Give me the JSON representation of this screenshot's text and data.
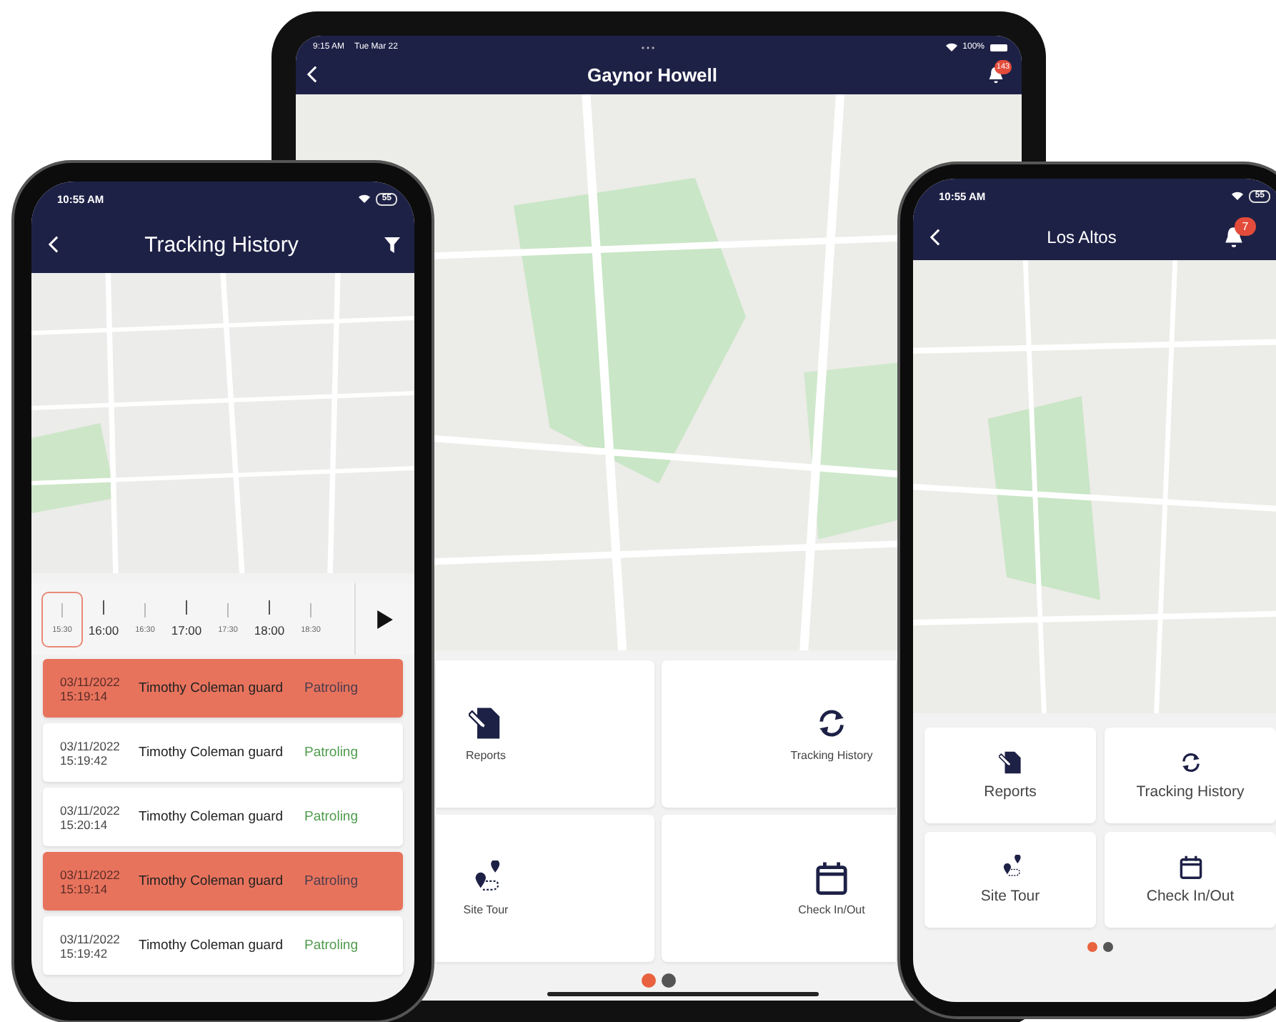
{
  "tablet": {
    "status_bar": {
      "time": "9:15 AM",
      "date": "Tue Mar 22",
      "battery": "100%"
    },
    "header": {
      "title": "Gaynor Howell",
      "notification_count": "143"
    },
    "tiles": [
      {
        "label": "Reports",
        "kind": "reports"
      },
      {
        "label": "Tracking History",
        "kind": "tracking"
      },
      {
        "label": "Site Tour",
        "kind": "tour"
      },
      {
        "label": "Check In/Out",
        "kind": "checkin"
      }
    ],
    "pages": [
      {
        "selected": true
      },
      {
        "selected": false
      }
    ]
  },
  "tracking_phone": {
    "status_bar": {
      "time": "10:55 AM",
      "battery": "55"
    },
    "header": {
      "title": "Tracking History"
    },
    "timeline": [
      {
        "label": "15:30",
        "kind": "minor",
        "selected": true
      },
      {
        "label": "16:00",
        "kind": "major",
        "selected": false
      },
      {
        "label": "16:30",
        "kind": "minor",
        "selected": false
      },
      {
        "label": "17:00",
        "kind": "major",
        "selected": false
      },
      {
        "label": "17:30",
        "kind": "minor",
        "selected": false
      },
      {
        "label": "18:00",
        "kind": "major",
        "selected": false
      },
      {
        "label": "18:30",
        "kind": "minor",
        "selected": false
      }
    ],
    "rows": [
      {
        "date": "03/11/2022",
        "time": "15:19:14",
        "name": "Timothy Coleman guard",
        "status": "Patroling",
        "selected": true
      },
      {
        "date": "03/11/2022",
        "time": "15:19:42",
        "name": "Timothy Coleman guard",
        "status": "Patroling",
        "selected": false
      },
      {
        "date": "03/11/2022",
        "time": "15:20:14",
        "name": "Timothy Coleman guard",
        "status": "Patroling",
        "selected": false
      },
      {
        "date": "03/11/2022",
        "time": "15:19:14",
        "name": "Timothy Coleman guard",
        "status": "Patroling",
        "selected": true
      },
      {
        "date": "03/11/2022",
        "time": "15:19:42",
        "name": "Timothy Coleman guard",
        "status": "Patroling",
        "selected": false
      }
    ]
  },
  "site_phone": {
    "status_bar": {
      "time": "10:55 AM",
      "battery": "55"
    },
    "header": {
      "title": "Los Altos",
      "notification_count": "7"
    },
    "tiles": [
      {
        "label": "Reports",
        "kind": "reports"
      },
      {
        "label": "Tracking History",
        "kind": "tracking"
      },
      {
        "label": "Site Tour",
        "kind": "tour"
      },
      {
        "label": "Check In/Out",
        "kind": "checkin"
      }
    ],
    "pages": [
      {
        "selected": true
      },
      {
        "selected": false
      }
    ]
  }
}
